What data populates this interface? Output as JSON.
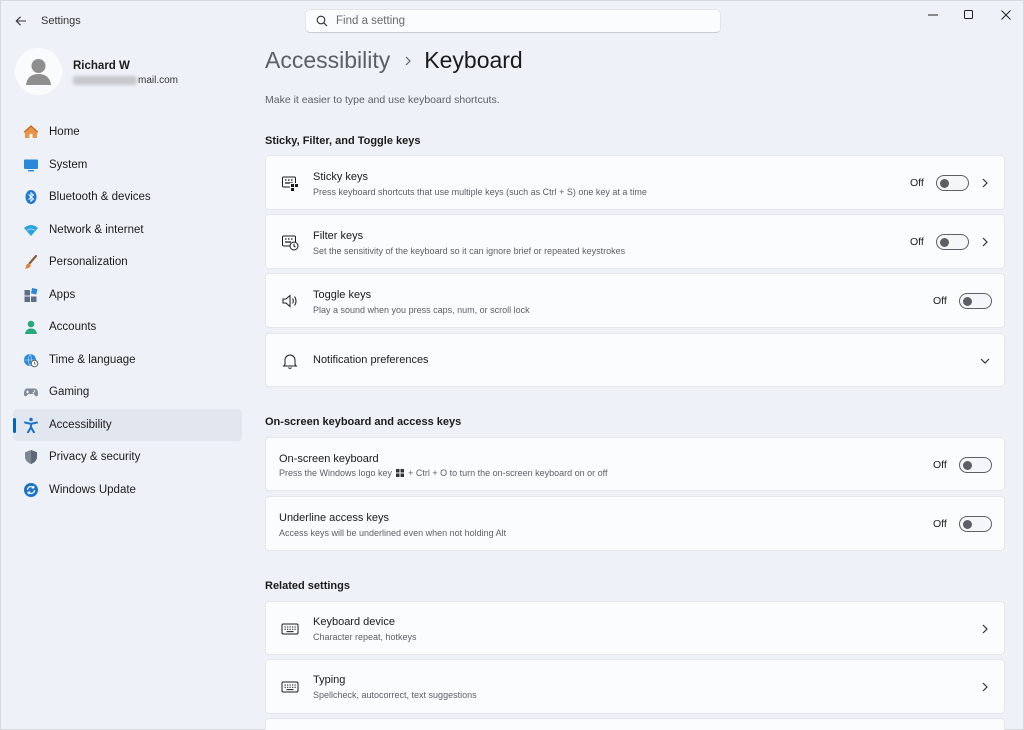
{
  "app": {
    "title": "Settings"
  },
  "search": {
    "placeholder": "Find a setting"
  },
  "profile": {
    "name": "Richard W",
    "email_suffix": "mail.com"
  },
  "sidebar": {
    "items": [
      {
        "label": "Home",
        "icon": "home-icon"
      },
      {
        "label": "System",
        "icon": "system-icon"
      },
      {
        "label": "Bluetooth & devices",
        "icon": "bluetooth-icon"
      },
      {
        "label": "Network & internet",
        "icon": "network-icon"
      },
      {
        "label": "Personalization",
        "icon": "brush-icon"
      },
      {
        "label": "Apps",
        "icon": "apps-icon"
      },
      {
        "label": "Accounts",
        "icon": "accounts-icon"
      },
      {
        "label": "Time & language",
        "icon": "globe-clock-icon"
      },
      {
        "label": "Gaming",
        "icon": "gamepad-icon"
      },
      {
        "label": "Accessibility",
        "icon": "accessibility-icon",
        "active": true
      },
      {
        "label": "Privacy & security",
        "icon": "shield-icon"
      },
      {
        "label": "Windows Update",
        "icon": "update-icon"
      }
    ]
  },
  "header": {
    "parent": "Accessibility",
    "current": "Keyboard",
    "subtitle": "Make it easier to type and use keyboard shortcuts."
  },
  "sections": {
    "sticky": "Sticky, Filter, and Toggle keys",
    "onscreen": "On-screen keyboard and access keys",
    "related": "Related settings"
  },
  "settings": {
    "sticky_keys": {
      "title": "Sticky keys",
      "desc": "Press keyboard shortcuts that use multiple keys (such as Ctrl + S) one key at a time",
      "state": "Off"
    },
    "filter_keys": {
      "title": "Filter keys",
      "desc": "Set the sensitivity of the keyboard so it can ignore brief or repeated keystrokes",
      "state": "Off"
    },
    "toggle_keys": {
      "title": "Toggle keys",
      "desc": "Play a sound when you press caps, num, or scroll lock",
      "state": "Off"
    },
    "notification": {
      "title": "Notification preferences"
    },
    "onscreen_keyboard": {
      "title": "On-screen keyboard",
      "desc_pre": "Press the Windows logo key",
      "desc_post": "+ Ctrl + O to turn the on-screen keyboard on or off",
      "state": "Off"
    },
    "underline_keys": {
      "title": "Underline access keys",
      "desc": "Access keys will be underlined even when not holding Alt",
      "state": "Off"
    },
    "keyboard_device": {
      "title": "Keyboard device",
      "desc": "Character repeat, hotkeys"
    },
    "typing": {
      "title": "Typing",
      "desc": "Spellcheck, autocorrect, text suggestions"
    }
  },
  "colors": {
    "accent": "#0067c0",
    "background": "#eef2f8",
    "card": "#fbfcfd"
  }
}
